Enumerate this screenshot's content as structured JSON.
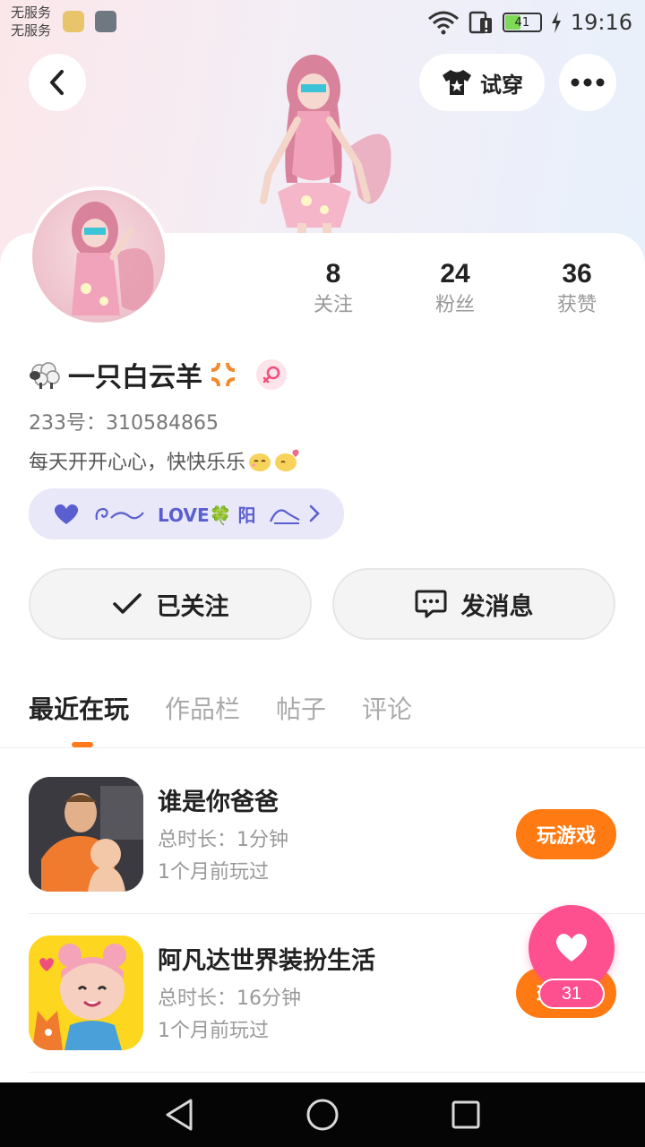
{
  "status_bar": {
    "carrier_line1": "无服务",
    "carrier_line2": "无服务",
    "battery_level": "41",
    "time": "19:16"
  },
  "header": {
    "try_on_label": "试穿"
  },
  "profile": {
    "stats": [
      {
        "value": "8",
        "label": "关注"
      },
      {
        "value": "24",
        "label": "粉丝"
      },
      {
        "value": "36",
        "label": "获赞"
      }
    ],
    "name": "一只白云羊",
    "user_id": "233号：310584865",
    "bio": "每天开开心心，快快乐乐",
    "cp_tag_text": "LOVE🍀 阳",
    "follow_button": "已关注",
    "message_button": "发消息"
  },
  "tabs": [
    {
      "label": "最近在玩",
      "active": true
    },
    {
      "label": "作品栏",
      "active": false
    },
    {
      "label": "帖子",
      "active": false
    },
    {
      "label": "评论",
      "active": false
    }
  ],
  "games": [
    {
      "title": "谁是你爸爸",
      "duration": "总时长：1分钟",
      "last_played": "1个月前玩过",
      "action": "玩游戏"
    },
    {
      "title": "阿凡达世界装扮生活",
      "duration": "总时长：16分钟",
      "last_played": "1个月前玩过",
      "action": "玩游戏"
    }
  ],
  "like_fab": {
    "count": "31"
  },
  "colors": {
    "accent_orange": "#ff7a12",
    "like_pink": "#fe4f8e",
    "cp_tag_bg": "#e9e8f9"
  }
}
